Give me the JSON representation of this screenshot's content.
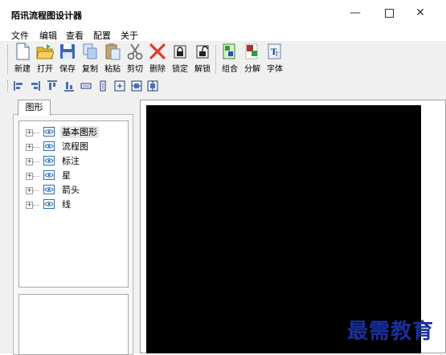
{
  "window": {
    "title": "陌讯流程图设计器",
    "controls": {
      "minimize": "—",
      "close": "✕"
    }
  },
  "menu": [
    "文件",
    "编辑",
    "查看",
    "配置",
    "关于"
  ],
  "toolbar": {
    "new": "新建",
    "open": "打开",
    "save": "保存",
    "copy": "复制",
    "paste": "粘贴",
    "cut": "剪切",
    "delete": "删除",
    "lock": "锁定",
    "unlock": "解锁",
    "group": "组合",
    "ungroup": "分解",
    "font": "字体"
  },
  "panel": {
    "tab": "图形",
    "tree": [
      "基本图形",
      "流程图",
      "标注",
      "星",
      "箭头",
      "线"
    ],
    "selected": "基本图形"
  },
  "watermark": "最需教育"
}
